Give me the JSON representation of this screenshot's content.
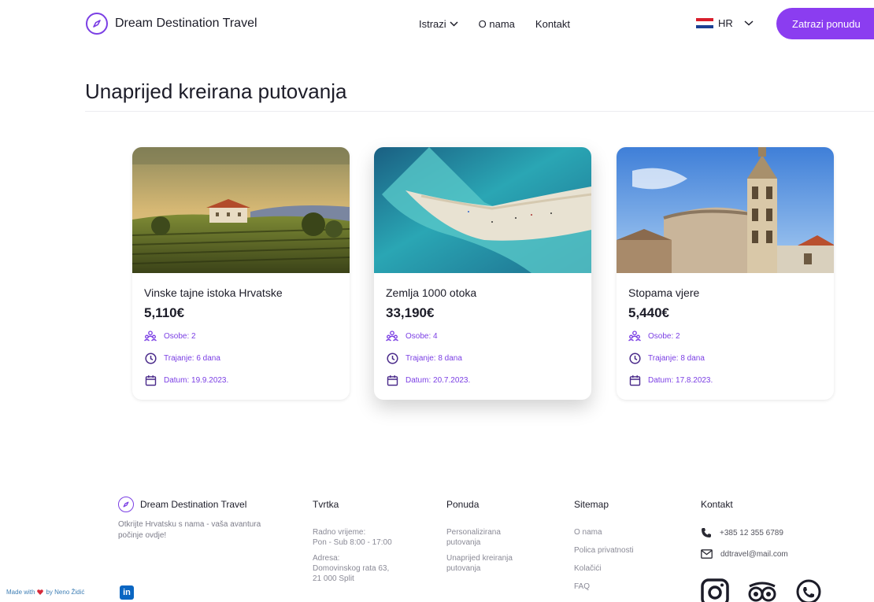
{
  "colors": {
    "accent": "#8b3df0",
    "accent_text": "#7b3fe4"
  },
  "header": {
    "logo_text": "Dream Destination Travel",
    "nav": [
      {
        "label": "Istrazi",
        "has_dropdown": true
      },
      {
        "label": "O nama"
      },
      {
        "label": "Kontakt"
      }
    ],
    "language": "HR",
    "cta_label": "Zatrazi ponudu"
  },
  "page_title": "Unaprijed kreirana putovanja",
  "cards": [
    {
      "title": "Vinske tajne istoka Hrvatske",
      "price": "5,110€",
      "persons": "Osobe: 2",
      "duration": "Trajanje: 6 dana",
      "date": "Datum: 19.9.2023."
    },
    {
      "title": "Zemlja 1000 otoka",
      "price": "33,190€",
      "persons": "Osobe: 4",
      "duration": "Trajanje: 8 dana",
      "date": "Datum: 20.7.2023."
    },
    {
      "title": "Stopama vjere",
      "price": "5,440€",
      "persons": "Osobe: 2",
      "duration": "Trajanje: 8 dana",
      "date": "Datum: 17.8.2023."
    }
  ],
  "footer": {
    "logo_text": "Dream Destination Travel",
    "tagline": "Otkrijte Hrvatsku s nama - vaša avantura počinje ovdje!",
    "company": {
      "heading": "Tvrtka",
      "hours_label": "Radno vrijeme:",
      "hours": "Pon - Sub 8:00 - 17:00",
      "address_label": "Adresa:",
      "address_line1": "Domovinskog rata 63,",
      "address_line2": "21 000 Split"
    },
    "offer": {
      "heading": "Ponuda",
      "links": [
        {
          "line1": "Personalizirana",
          "line2": "putovanja"
        },
        {
          "line1": "Unaprijed kreiranja",
          "line2": "putovanja"
        }
      ]
    },
    "sitemap": {
      "heading": "Sitemap",
      "links": [
        "O nama",
        "Polica privatnosti",
        "Kolačići",
        "FAQ"
      ]
    },
    "contact": {
      "heading": "Kontakt",
      "phone": "+385 12 355 6789",
      "email": "ddtravel@mail.com"
    },
    "credit": {
      "prefix": "Made with",
      "suffix": "by Neno Židić",
      "linkedin": "in"
    }
  }
}
